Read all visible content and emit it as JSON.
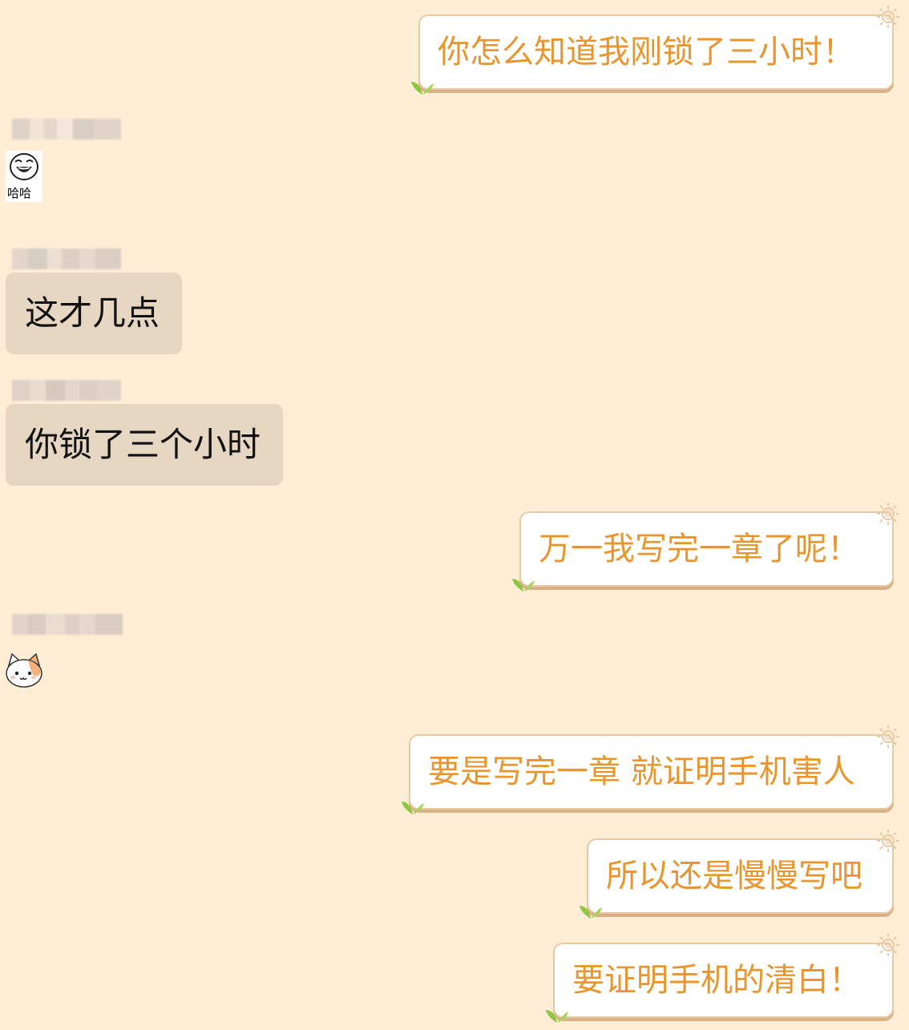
{
  "colors": {
    "background": "#FFEDD6",
    "outgoing_text": "#E8952E",
    "outgoing_border": "#E8C9A1",
    "incoming_bubble": "#E6D6C2",
    "incoming_text": "#111111"
  },
  "messages": [
    {
      "side": "outgoing",
      "text": "你怎么知道我刚锁了三小时！"
    },
    {
      "side": "incoming",
      "type": "sticker",
      "sticker_icon": "laughing-face-sticker",
      "caption": "哈哈"
    },
    {
      "side": "incoming",
      "text": "这才几点"
    },
    {
      "side": "incoming",
      "text": "你锁了三个小时"
    },
    {
      "side": "outgoing",
      "text": "万一我写完一章了呢！"
    },
    {
      "side": "incoming",
      "type": "sticker",
      "sticker_icon": "cat-face-sticker"
    },
    {
      "side": "outgoing",
      "text": "要是写完一章 就证明手机害人"
    },
    {
      "side": "outgoing",
      "text": "所以还是慢慢写吧"
    },
    {
      "side": "outgoing",
      "text": "要证明手机的清白！"
    }
  ]
}
